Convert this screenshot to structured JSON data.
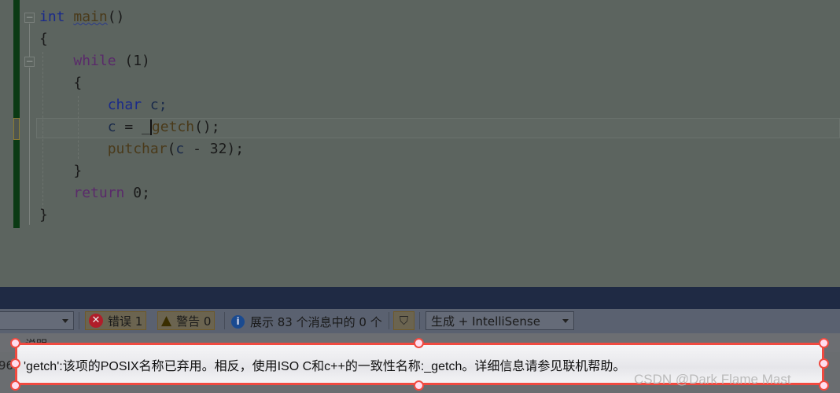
{
  "editor": {
    "lines": [
      [
        {
          "t": "int",
          "c": "kw"
        },
        {
          "t": " "
        },
        {
          "t": "main",
          "c": "fn squig"
        },
        {
          "t": "()"
        }
      ],
      [
        {
          "t": "{"
        }
      ],
      [
        {
          "t": "    "
        },
        {
          "t": "while",
          "c": "kw2"
        },
        {
          "t": " (1)"
        }
      ],
      [
        {
          "t": "    {"
        }
      ],
      [
        {
          "t": "        "
        },
        {
          "t": "char",
          "c": "kw"
        },
        {
          "t": " c;",
          "c": "var"
        }
      ],
      [
        {
          "t": "        "
        },
        {
          "t": "c",
          "c": "var"
        },
        {
          "t": " = _"
        },
        {
          "t": "CARET"
        },
        {
          "t": "getch",
          "c": "fn"
        },
        {
          "t": "();"
        }
      ],
      [
        {
          "t": "        "
        },
        {
          "t": "putchar",
          "c": "fn"
        },
        {
          "t": "("
        },
        {
          "t": "c",
          "c": "var"
        },
        {
          "t": " - 32);"
        }
      ],
      [
        {
          "t": "    }"
        }
      ],
      [
        {
          "t": "    "
        },
        {
          "t": "return",
          "c": "kw2"
        },
        {
          "t": " 0;"
        }
      ],
      [
        {
          "t": "}"
        }
      ]
    ]
  },
  "toolbar": {
    "errors": "错误 1",
    "warnings": "警告 0",
    "messages": "展示 83 个消息中的 0 个",
    "build_filter": "生成 + IntelliSense"
  },
  "header": {
    "description": "说明",
    "code_partial": "96"
  },
  "message": "'getch':该项的POSIX名称已弃用。相反，使用ISO C和c++的一致性名称:_getch。详细信息请参见联机帮助。",
  "watermark": "CSDN @Dark Flame Mast",
  "colors": {
    "highlight_border": "#f04a40",
    "error": "#b01e2a",
    "warning": "#e0b000",
    "info": "#1a5aa8"
  }
}
